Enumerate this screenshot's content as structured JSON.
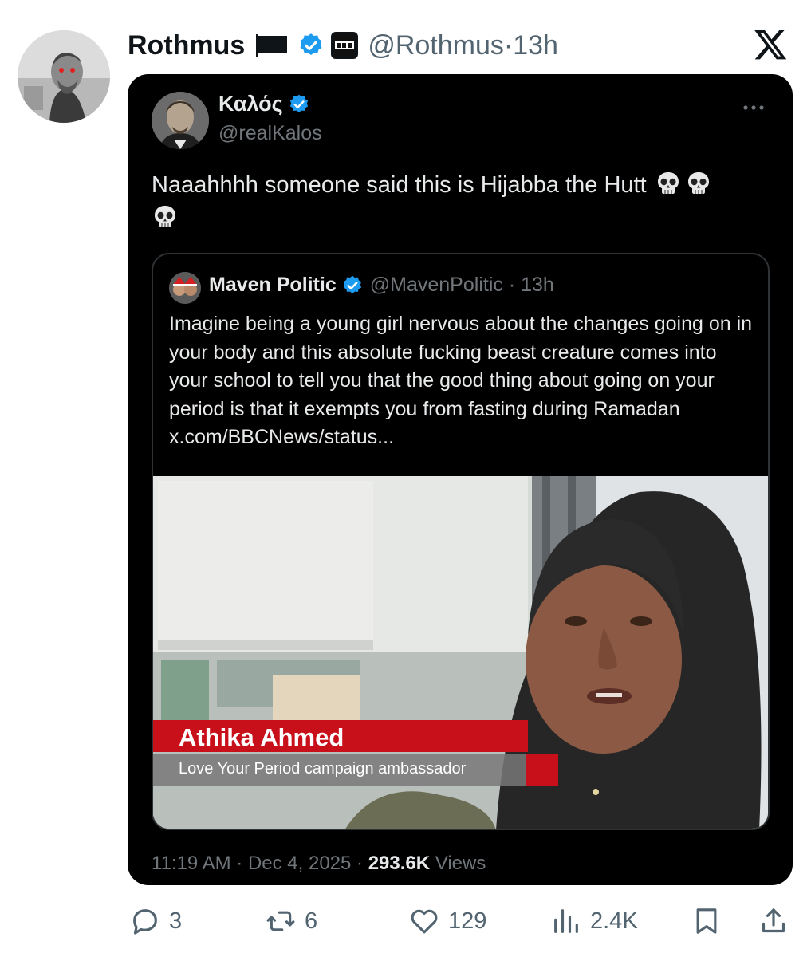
{
  "post": {
    "author_name": "Rothmus",
    "handle": "@Rothmus",
    "separator": "·",
    "time": "13h",
    "icons": [
      "black-flag-icon",
      "verified-icon",
      "affiliate-badge-icon",
      "x-logo-icon"
    ]
  },
  "screenshot": {
    "author_name": "Καλός",
    "handle": "@realKalos",
    "text": "Naaahhhh someone said this is Hijabba the Hutt",
    "emojis": [
      "skull-icon",
      "skull-icon",
      "skull-icon"
    ],
    "quoted": {
      "author_name": "Maven Politic",
      "handle": "@MavenPolitic",
      "separator": "·",
      "time": "13h",
      "text": "Imagine being a young girl nervous about the changes going on in your body and this absolute fucking beast creature comes into your school to tell you that the good thing about going on your period is that it exempts you from fasting during Ramadan",
      "link": "x.com/BBCNews/status...",
      "media": {
        "lower_third_name": "Athika Ahmed",
        "lower_third_subtitle": "Love Your Period campaign ambassador"
      }
    },
    "timestamp": "11:19 AM · Dec 4, 2025 ·",
    "views_count": "293.6K",
    "views_label": "Views"
  },
  "actions": {
    "replies": "3",
    "reposts": "6",
    "likes": "129",
    "views": "2.4K"
  },
  "colors": {
    "verified_blue": "#1d9bf0",
    "secondary_text": "#536471",
    "bbc_red": "#c8101a"
  }
}
